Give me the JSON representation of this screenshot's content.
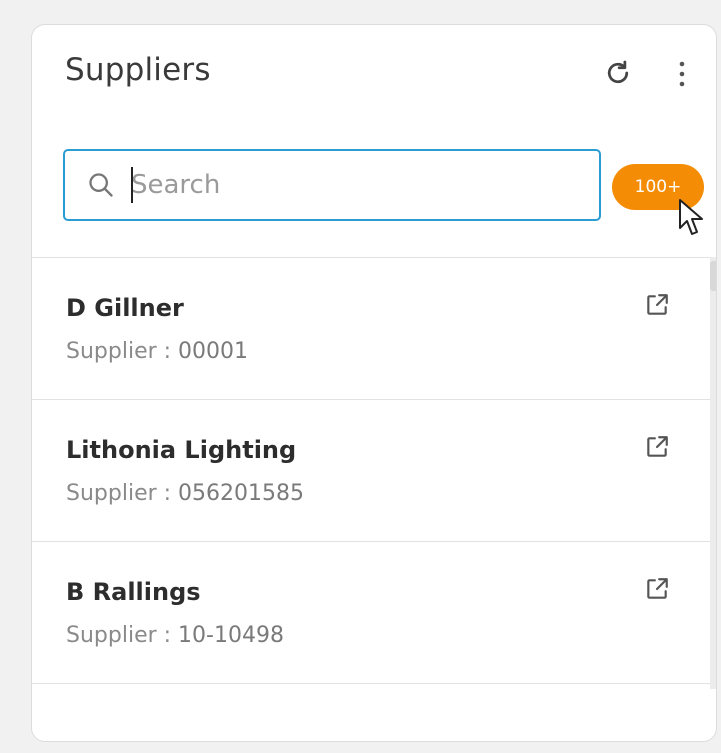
{
  "panel": {
    "title": "Suppliers"
  },
  "search": {
    "placeholder": "Search",
    "value": ""
  },
  "count_badge": {
    "label": "100+",
    "color": "#f48c06"
  },
  "icons": {
    "refresh": "refresh-icon",
    "more": "more-vertical-icon",
    "search": "search-icon",
    "external": "external-link-icon"
  },
  "suppliers": [
    {
      "name": "D Gillner",
      "prefix": "Supplier : ",
      "id": "00001"
    },
    {
      "name": "Lithonia Lighting",
      "prefix": "Supplier : ",
      "id": "056201585"
    },
    {
      "name": "B Rallings",
      "prefix": "Supplier : ",
      "id": "10-10498"
    }
  ],
  "accent_color": "#2c9dd2"
}
